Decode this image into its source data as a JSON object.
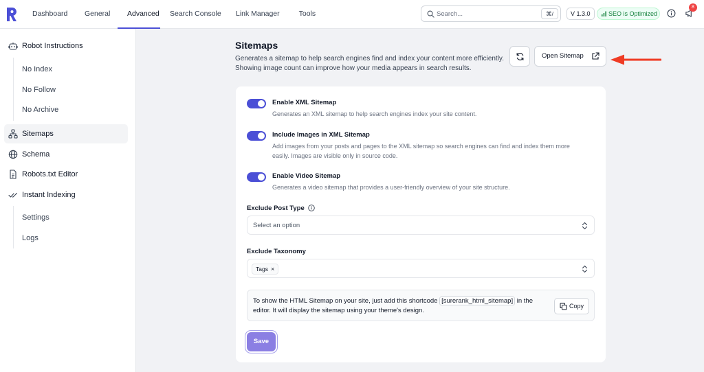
{
  "nav": {
    "items": [
      "Dashboard",
      "General",
      "Advanced",
      "Search Console",
      "Link Manager",
      "Tools"
    ],
    "active": "Advanced"
  },
  "header": {
    "search_placeholder": "Search...",
    "search_shortcut": "⌘/",
    "version": "V 1.3.0",
    "seo_status": "SEO is Optimized",
    "notification_count": "8",
    "accent_color": "#4b4fd6",
    "status_color": "#15803d"
  },
  "sidebar": {
    "robot_instructions": "Robot Instructions",
    "robot_sub": [
      "No Index",
      "No Follow",
      "No Archive"
    ],
    "sitemaps": "Sitemaps",
    "schema": "Schema",
    "robots_editor": "Robots.txt Editor",
    "instant_indexing": "Instant Indexing",
    "indexing_sub": [
      "Settings",
      "Logs"
    ]
  },
  "main": {
    "title": "Sitemaps",
    "description": "Generates a sitemap to help search engines find and index your content more efficiently. Showing image count can improve how your media appears in search results.",
    "open_sitemap": "Open Sitemap",
    "toggles": [
      {
        "title": "Enable XML Sitemap",
        "desc": "Generates an XML sitemap to help search engines index your site content.",
        "enabled": true
      },
      {
        "title": "Include Images in XML Sitemap",
        "desc": "Add images from your posts and pages to the XML sitemap so search engines can find and index them more easily. Images are visible only in source code.",
        "enabled": true
      },
      {
        "title": "Enable Video Sitemap",
        "desc": "Generates a video sitemap that provides a user-friendly overview of your site structure.",
        "enabled": true
      }
    ],
    "exclude_post_type_label": "Exclude Post Type",
    "exclude_post_type_placeholder": "Select an option",
    "exclude_taxonomy_label": "Exclude Taxonomy",
    "taxonomy_tags": [
      "Tags"
    ],
    "note_prefix": "To show the HTML Sitemap on your site, just add this shortcode",
    "note_code": "[surerank_html_sitemap]",
    "note_suffix": "in the editor. It will display the sitemap using your theme's design.",
    "copy_label": "Copy",
    "save_label": "Save"
  }
}
